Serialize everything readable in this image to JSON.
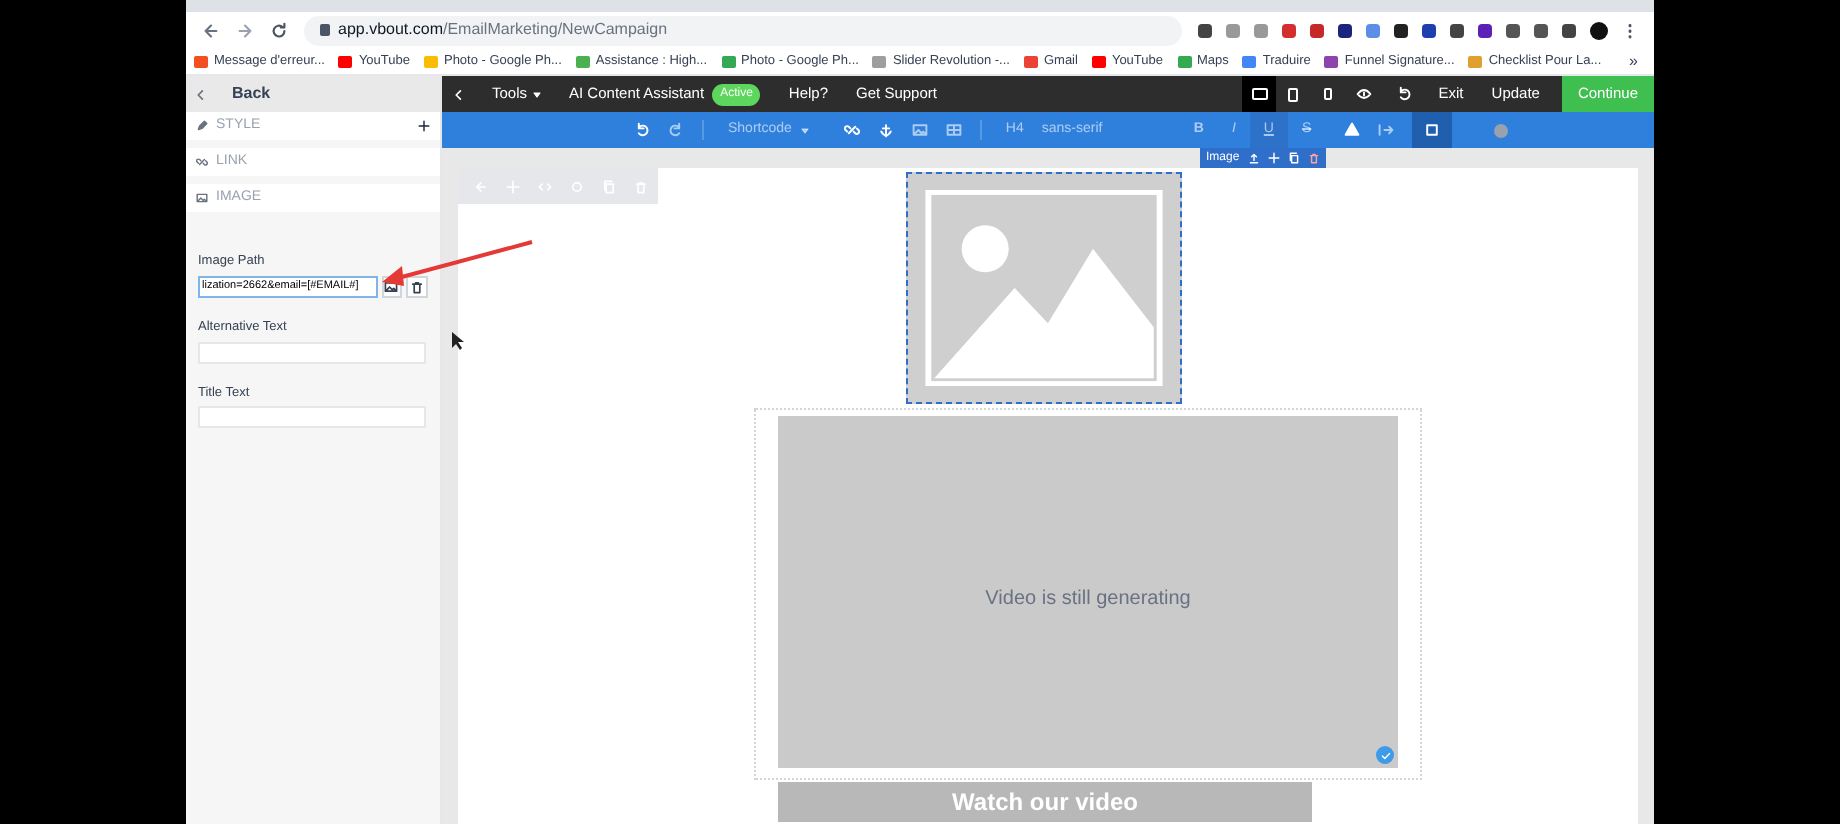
{
  "browser": {
    "url_host": "app.vbout.com",
    "url_path": "/EmailMarketing/NewCampaign",
    "bookmarks": [
      {
        "label": "Message d'erreur...",
        "color": "#f25022"
      },
      {
        "label": "YouTube",
        "color": "#ff0000"
      },
      {
        "label": "Photo - Google Ph...",
        "color": "#fbbc05"
      },
      {
        "label": "Assistance : High...",
        "color": "#4caf50"
      },
      {
        "label": "Photo - Google Ph...",
        "color": "#34a853"
      },
      {
        "label": "Slider Revolution -...",
        "color": "#9e9e9e"
      },
      {
        "label": "Gmail",
        "color": "#ea4335"
      },
      {
        "label": "YouTube",
        "color": "#ff0000"
      },
      {
        "label": "Maps",
        "color": "#34a853"
      },
      {
        "label": "Traduire",
        "color": "#4285f4"
      },
      {
        "label": "Funnel Signature...",
        "color": "#8e44ad"
      },
      {
        "label": "Checklist Pour La...",
        "color": "#e0a030"
      }
    ],
    "more": "»"
  },
  "sidebar": {
    "back": "Back",
    "sections": [
      {
        "kind": "style",
        "label": "STYLE"
      },
      {
        "kind": "link",
        "label": "LINK"
      },
      {
        "kind": "image",
        "label": "IMAGE"
      }
    ],
    "fields": [
      {
        "label": "Image Path",
        "value": "lization=2662&email=[#EMAIL#]",
        "kind": "path"
      },
      {
        "label": "Alternative Text",
        "kind": "text"
      },
      {
        "label": "Title Text",
        "kind": "text"
      }
    ]
  },
  "topbar": {
    "menu": [
      {
        "label": "Tools",
        "dropdown": true
      },
      {
        "label": "AI Content Assistant",
        "badge": "Active",
        "dropdown": false
      },
      {
        "label": "Help?",
        "dropdown": false
      },
      {
        "label": "Get Support",
        "dropdown": false
      }
    ],
    "devices": [
      {
        "kind": "desktop",
        "selected": true
      },
      {
        "kind": "tablet",
        "selected": false
      },
      {
        "kind": "phone",
        "selected": false
      }
    ],
    "actions": [
      {
        "label": "Exit",
        "kind": "plain"
      },
      {
        "label": "Update",
        "kind": "plain"
      },
      {
        "label": "Continue",
        "kind": "primary"
      }
    ]
  },
  "toolbar": {
    "shortcode": "Shortcode",
    "heading": "H4",
    "font": "sans-serif",
    "formats": [
      {
        "label": "B",
        "selected": false
      },
      {
        "label": "I",
        "selected": false
      },
      {
        "label": "U",
        "selected": true
      },
      {
        "label": "S",
        "selected": false
      }
    ]
  },
  "canvas": {
    "image_label": "Image",
    "video_text": "Video is still generating",
    "button": "Watch our video"
  }
}
